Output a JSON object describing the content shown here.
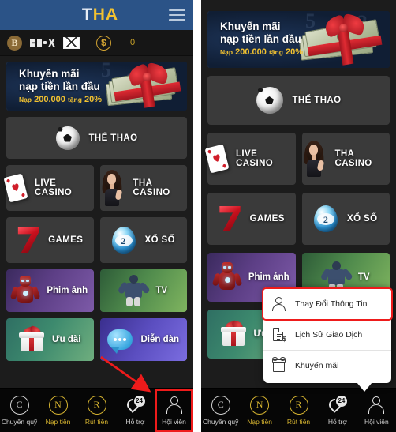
{
  "app": {
    "title_initial": "T",
    "title_rest": "HA",
    "menu_icon": "hamburger-icon"
  },
  "account_strip": {
    "bonus_badge": "B",
    "brand_logo": "brand-logo-icon",
    "mail_icon": "envelope-icon",
    "currency_icon": "dollar-coin-icon",
    "balance": "0"
  },
  "promo_banner": {
    "line1": "Khuyến mãi",
    "line2": "nạp tiền lần đầu",
    "line3_prefix": "Nạp",
    "line3_amount": "200.000",
    "line3_mid": "tặng",
    "line3_percent": "20%"
  },
  "tiles": {
    "sports": {
      "label": "THỂ THAO",
      "icon": "soccer-ball-icon"
    },
    "live_casino": {
      "label": "LIVE CASINO",
      "icon": "playing-card-icon"
    },
    "tha_casino": {
      "label": "THA CASINO",
      "icon": "dealer-girl-icon"
    },
    "games": {
      "label": "GAMES",
      "icon": "slot-seven-icon"
    },
    "lottery": {
      "label": "XỔ SỐ",
      "icon": "lottery-ball-icon",
      "ball_number": "2"
    },
    "movies": {
      "label": "Phim ảnh",
      "icon": "superhero-icon"
    },
    "tv": {
      "label": "TV",
      "icon": "baseball-player-icon"
    },
    "offers": {
      "label": "Ưu đãi",
      "icon": "gift-box-icon"
    },
    "forum": {
      "label": "Diễn đàn",
      "icon": "chat-bubble-icon"
    }
  },
  "bottom_nav": [
    {
      "label": "Chuyển quỹ",
      "glyph": "C",
      "icon": "transfer-funds-icon",
      "gold": false
    },
    {
      "label": "Nạp tiền",
      "glyph": "N",
      "icon": "deposit-icon",
      "gold": true
    },
    {
      "label": "Rút tiền",
      "glyph": "R",
      "icon": "withdraw-icon",
      "gold": true
    },
    {
      "label": "Hỗ trợ",
      "glyph": "24",
      "icon": "support-24h-icon",
      "gold": false
    },
    {
      "label": "Hội viên",
      "glyph": "",
      "icon": "member-icon",
      "gold": false
    }
  ],
  "popup_menu": {
    "items": [
      {
        "label": "Thay Đổi Thông Tin",
        "icon": "user-profile-icon",
        "highlighted": true
      },
      {
        "label": "Lịch Sử Giao Dịch",
        "icon": "transaction-history-icon",
        "highlighted": false
      },
      {
        "label": "Khuyến mãi",
        "icon": "gift-icon",
        "highlighted": false
      }
    ]
  },
  "colors": {
    "appbar": "#2b5387",
    "accent_gold": "#f2c230",
    "card_bg": "#3a3a3a",
    "page_bg": "#1c1c1c",
    "nav_bg": "#060606",
    "annotation_red": "#ee1b1b"
  }
}
